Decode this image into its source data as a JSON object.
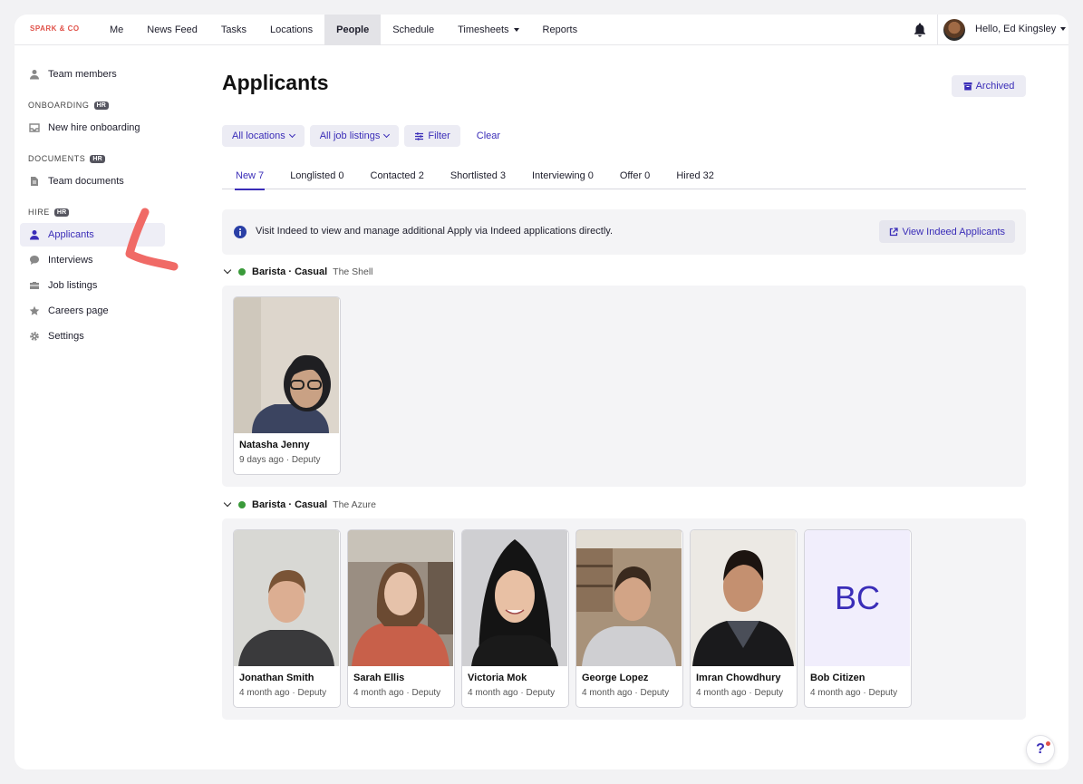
{
  "brand": "SPARK & CO",
  "nav": {
    "items": [
      {
        "label": "Me"
      },
      {
        "label": "News Feed"
      },
      {
        "label": "Tasks"
      },
      {
        "label": "Locations"
      },
      {
        "label": "People",
        "active": true
      },
      {
        "label": "Schedule"
      },
      {
        "label": "Timesheets",
        "dropdown": true
      },
      {
        "label": "Reports"
      }
    ],
    "user_greeting": "Hello, Ed Kingsley"
  },
  "sidebar": {
    "top": [
      {
        "label": "Team members",
        "icon": "person-icon"
      }
    ],
    "sections": [
      {
        "title": "ONBOARDING",
        "badge": "HR",
        "items": [
          {
            "label": "New hire onboarding",
            "icon": "inbox-icon"
          }
        ]
      },
      {
        "title": "DOCUMENTS",
        "badge": "HR",
        "items": [
          {
            "label": "Team documents",
            "icon": "document-icon"
          }
        ]
      },
      {
        "title": "HIRE",
        "badge": "HR",
        "items": [
          {
            "label": "Applicants",
            "icon": "person-icon",
            "active": true
          },
          {
            "label": "Interviews",
            "icon": "chat-icon"
          },
          {
            "label": "Job listings",
            "icon": "briefcase-icon"
          },
          {
            "label": "Careers page",
            "icon": "star-icon"
          },
          {
            "label": "Settings",
            "icon": "gear-icon"
          }
        ]
      }
    ]
  },
  "page": {
    "title": "Applicants",
    "archived_label": "Archived",
    "filters": {
      "locations": "All locations",
      "job_listings": "All job listings",
      "filter": "Filter",
      "clear": "Clear"
    },
    "tabs": [
      {
        "label": "New 7",
        "active": true
      },
      {
        "label": "Longlisted 0"
      },
      {
        "label": "Contacted 2"
      },
      {
        "label": "Shortlisted 3"
      },
      {
        "label": "Interviewing 0"
      },
      {
        "label": "Offer 0"
      },
      {
        "label": "Hired 32"
      }
    ],
    "info": {
      "text": "Visit Indeed to view and manage additional Apply via Indeed applications directly.",
      "button": "View Indeed Applicants"
    }
  },
  "groups": [
    {
      "title": "Barista · Casual",
      "location": "The Shell",
      "status_color": "#3a9a3a",
      "applicants": [
        {
          "name": "Natasha Jenny",
          "meta": "9 days ago · Deputy"
        }
      ]
    },
    {
      "title": "Barista · Casual",
      "location": "The Azure",
      "status_color": "#3a9a3a",
      "applicants": [
        {
          "name": "Jonathan Smith",
          "meta": "4 month ago · Deputy"
        },
        {
          "name": "Sarah Ellis",
          "meta": "4 month ago · Deputy"
        },
        {
          "name": "Victoria Mok",
          "meta": "4 month ago · Deputy"
        },
        {
          "name": "George Lopez",
          "meta": "4 month ago · Deputy"
        },
        {
          "name": "Imran Chowdhury",
          "meta": "4 month ago · Deputy"
        },
        {
          "name": "Bob Citizen",
          "meta": "4 month ago · Deputy",
          "initials": "BC"
        }
      ]
    }
  ],
  "help_label": "?",
  "colors": {
    "accent": "#3a2db8",
    "brand": "#e0524a",
    "status_green": "#3a9a3a"
  }
}
